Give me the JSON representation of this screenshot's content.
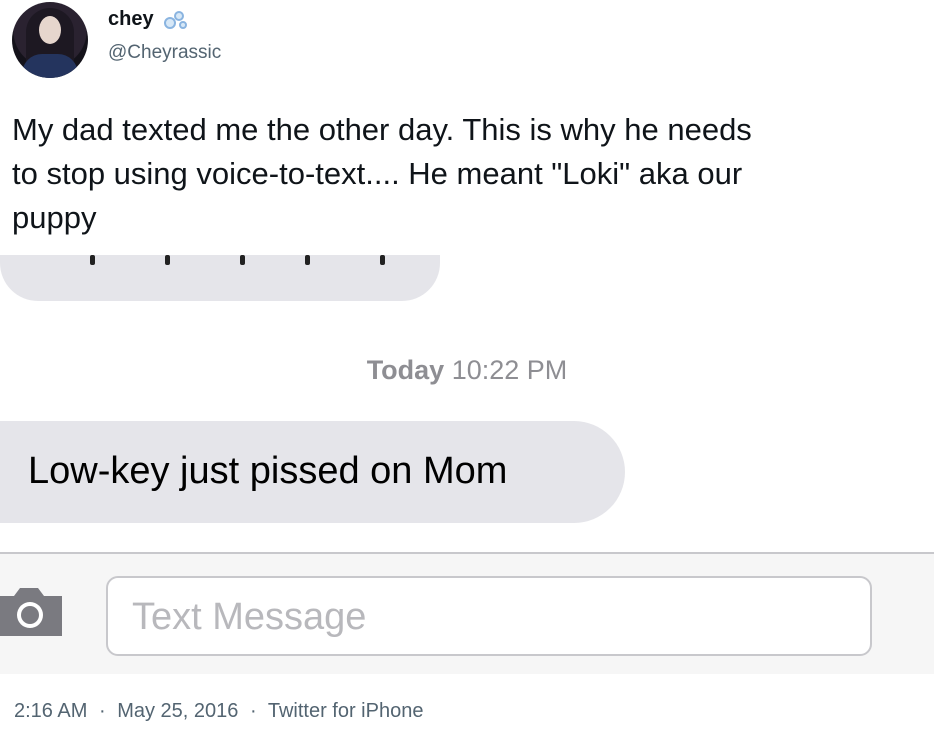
{
  "tweet": {
    "author": {
      "name": "chey",
      "handle": "@Cheyrassic",
      "avatar": "avatar-photo",
      "badge_icon": "bubbles-icon"
    },
    "text_lines": [
      "My dad texted me the other day. This is why he needs",
      "to stop using voice-to-text.... He meant \"Loki\" aka our",
      "puppy"
    ],
    "footer": {
      "time": "2:16 AM",
      "date": "May 25, 2016",
      "source": "Twitter for iPhone",
      "separator": "·"
    }
  },
  "sms": {
    "timestamp_day": "Today",
    "timestamp_time": "10:22 PM",
    "message": "Low-key just pissed on Mom",
    "compose": {
      "placeholder": "Text Message",
      "camera_icon": "camera-icon"
    },
    "colors": {
      "bubble": "#e5e5ea",
      "timestamp": "#8e8e93",
      "placeholder": "#b8b8bc"
    }
  }
}
